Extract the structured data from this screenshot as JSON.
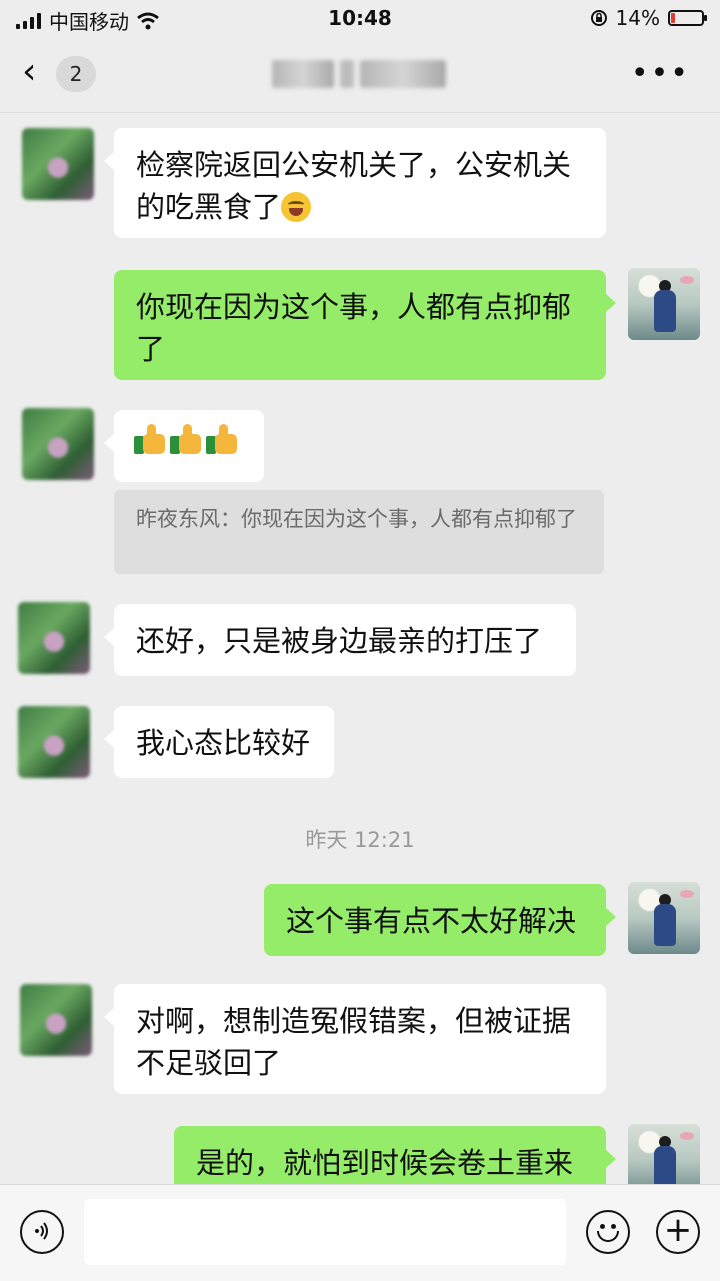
{
  "status_bar": {
    "carrier": "中国移动",
    "time": "10:48",
    "battery": "14%",
    "battery_level": 0.14,
    "icons": [
      "signal-icon",
      "wifi-icon",
      "rotation-lock-icon",
      "battery-icon"
    ]
  },
  "nav": {
    "back_icon": "chevron-left-icon",
    "unread_count": "2",
    "more_icon": "more-dots-icon"
  },
  "messages": [
    {
      "from": "them",
      "text": "检察院返回公安机关了，公安机关的吃黑食了",
      "emoji": "laughing-crying-emoji"
    },
    {
      "from": "me",
      "text": "你现在因为这个事，人都有点抑郁了"
    },
    {
      "from": "them",
      "emoji": "thumbs-up x3"
    },
    {
      "from": "them",
      "quote": "昨夜东风：你现在因为这个事，人都有点抑郁了"
    },
    {
      "from": "them",
      "text": "还好，只是被身边最亲的打压了"
    },
    {
      "from": "them",
      "text": "我心态比较好"
    },
    {
      "from": "me",
      "text": "这个事有点不太好解决"
    },
    {
      "from": "them",
      "text": "对啊，想制造冤假错案，但被证据不足驳回了"
    },
    {
      "from": "me",
      "text": "是的，就怕到时候会卷土重来"
    }
  ],
  "timestamp": "昨天 12:21",
  "input_bar": {
    "voice_icon": "voice-icon",
    "emoji_icon": "emoji-icon",
    "plus_icon": "plus-icon",
    "input_value": ""
  },
  "colors": {
    "background": "#ededed",
    "my_bubble": "#95ec69",
    "their_bubble": "#ffffff"
  }
}
